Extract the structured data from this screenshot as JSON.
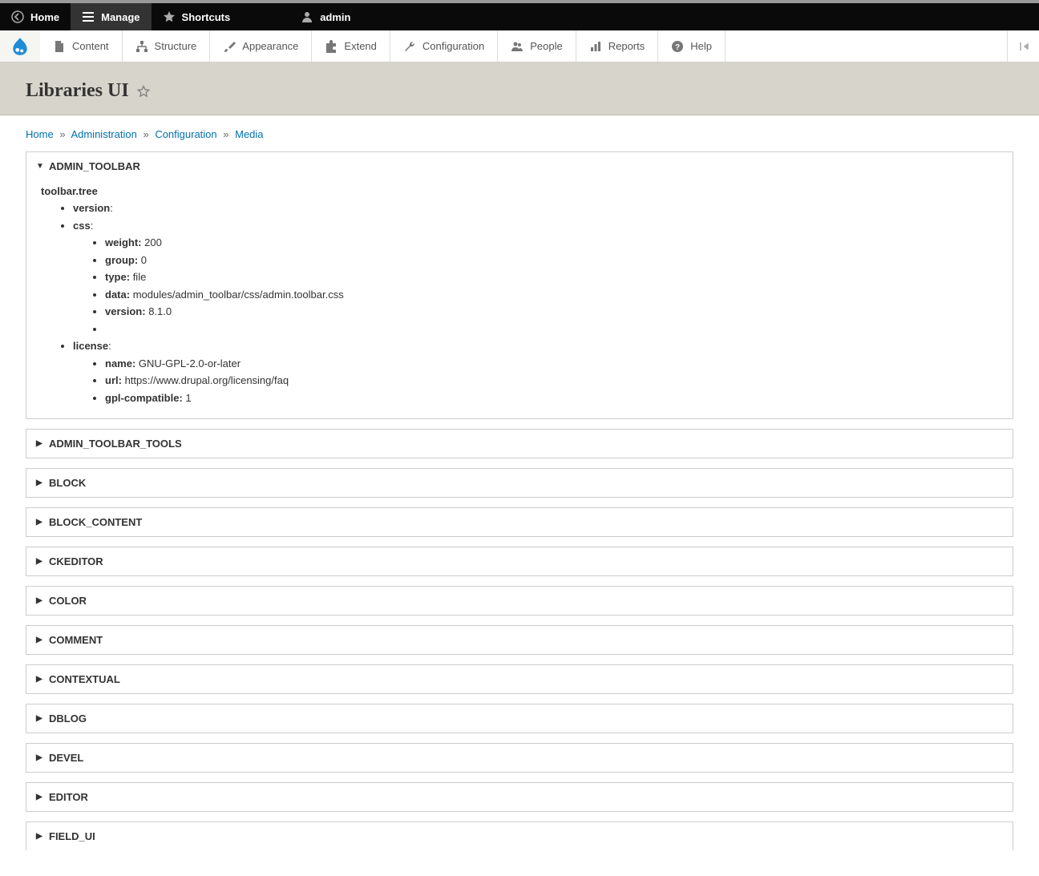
{
  "topbar": {
    "home": "Home",
    "manage": "Manage",
    "shortcuts": "Shortcuts",
    "admin": "admin"
  },
  "adminbar": {
    "content": "Content",
    "structure": "Structure",
    "appearance": "Appearance",
    "extend": "Extend",
    "configuration": "Configuration",
    "people": "People",
    "reports": "Reports",
    "help": "Help"
  },
  "page": {
    "title": "Libraries UI"
  },
  "breadcrumbs": {
    "home": "Home",
    "administration": "Administration",
    "configuration": "Configuration",
    "media": "Media"
  },
  "panels": {
    "admin_toolbar": {
      "title": "ADMIN_TOOLBAR",
      "lib_name": "toolbar.tree",
      "version_k": "version",
      "css_k": "css",
      "weight_k": "weight:",
      "weight_v": "200",
      "group_k": "group:",
      "group_v": "0",
      "type_k": "type:",
      "type_v": "file",
      "data_k": "data:",
      "data_v": "modules/admin_toolbar/css/admin.toolbar.css",
      "ver_k": "version:",
      "ver_v": "8.1.0",
      "license_k": "license",
      "name_k": "name:",
      "name_v": "GNU-GPL-2.0-or-later",
      "url_k": "url:",
      "url_v": "https://www.drupal.org/licensing/faq",
      "gpl_k": "gpl-compatible:",
      "gpl_v": "1"
    },
    "admin_toolbar_tools": "ADMIN_TOOLBAR_TOOLS",
    "block": "BLOCK",
    "block_content": "BLOCK_CONTENT",
    "ckeditor": "CKEDITOR",
    "color": "COLOR",
    "comment": "COMMENT",
    "contextual": "CONTEXTUAL",
    "dblog": "DBLOG",
    "devel": "DEVEL",
    "editor": "EDITOR",
    "field_ui": "FIELD_UI"
  }
}
